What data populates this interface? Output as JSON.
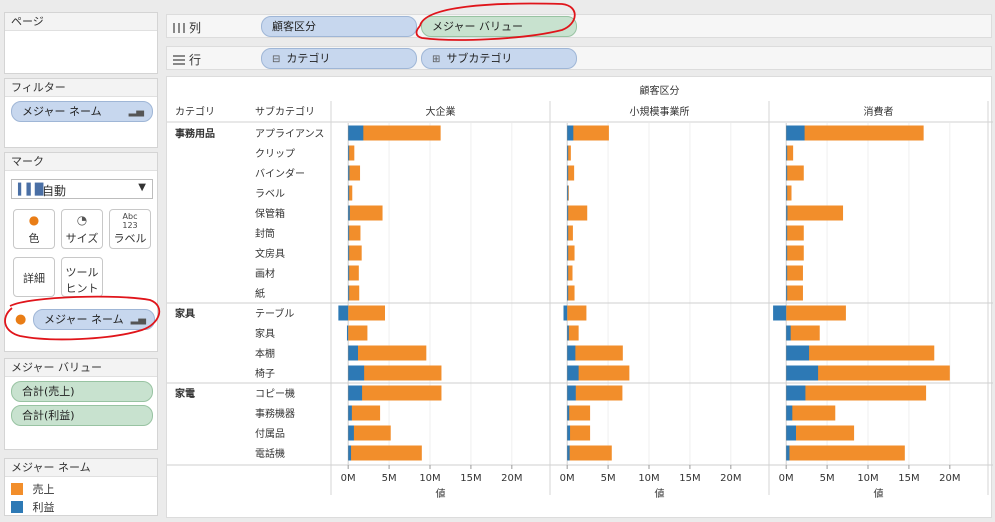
{
  "pages_panel": {
    "title": "ページ"
  },
  "filters_panel": {
    "title": "フィルター",
    "pill": "メジャー ネーム"
  },
  "marks_panel": {
    "title": "マーク",
    "mark_type": "自動",
    "buttons": {
      "color": "色",
      "size": "サイズ",
      "label": "ラベル",
      "detail": "詳細",
      "tooltip_line1": "ツール",
      "tooltip_line2": "ヒント",
      "label_icon_line1": "Abc",
      "label_icon_line2": "123"
    },
    "color_pill": "メジャー ネーム"
  },
  "measure_values_panel": {
    "title": "メジャー バリュー",
    "items": [
      "合計(売上)",
      "合計(利益)"
    ]
  },
  "legend_panel": {
    "title": "メジャー ネーム",
    "items": [
      {
        "label": "売上",
        "color": "#f28e2b"
      },
      {
        "label": "利益",
        "color": "#2d79b5"
      }
    ]
  },
  "columns_shelf": {
    "label": "列",
    "pills": [
      "顧客区分",
      "メジャー バリュー"
    ]
  },
  "rows_shelf": {
    "label": "行",
    "pills": [
      "カテゴリ",
      "サブカテゴリ"
    ],
    "pill_prefix": [
      "⊟",
      "⊞"
    ]
  },
  "chart_data": {
    "type": "bar",
    "orientation": "horizontal",
    "stacked_overlay": true,
    "column_header_title": "顧客区分",
    "row_header_labels": [
      "カテゴリ",
      "サブカテゴリ"
    ],
    "segments": [
      "大企業",
      "小規模事業所",
      "消費者"
    ],
    "xlabel": "値",
    "xlim": [
      -1000000,
      21000000
    ],
    "xticks": [
      0,
      5000000,
      10000000,
      15000000,
      20000000
    ],
    "xtick_labels": [
      "0M",
      "5M",
      "10M",
      "15M",
      "20M"
    ],
    "groups": [
      {
        "category": "事務用品",
        "subcategories": [
          "アプライアンス",
          "クリップ",
          "バインダー",
          "ラベル",
          "保管箱",
          "封筒",
          "文房具",
          "画材",
          "紙"
        ]
      },
      {
        "category": "家具",
        "subcategories": [
          "テーブル",
          "家具",
          "本棚",
          "椅子"
        ]
      },
      {
        "category": "家電",
        "subcategories": [
          "コピー機",
          "事務機器",
          "付属品",
          "電話機"
        ]
      }
    ],
    "series": [
      {
        "name": "売上",
        "color": "#f28e2b",
        "values": [
          [
            11300000,
            5100000,
            16800000
          ],
          [
            750000,
            450000,
            850000
          ],
          [
            1450000,
            850000,
            2150000
          ],
          [
            500000,
            200000,
            650000
          ],
          [
            4200000,
            2450000,
            6950000
          ],
          [
            1500000,
            700000,
            2150000
          ],
          [
            1650000,
            900000,
            2150000
          ],
          [
            1300000,
            650000,
            2050000
          ],
          [
            1350000,
            900000,
            2050000
          ],
          [
            4500000,
            2350000,
            7300000
          ],
          [
            2350000,
            1400000,
            4100000
          ],
          [
            9550000,
            6800000,
            18100000
          ],
          [
            11400000,
            7600000,
            20000000
          ],
          [
            11400000,
            6750000,
            17100000
          ],
          [
            3900000,
            2800000,
            6000000
          ],
          [
            5200000,
            2800000,
            8300000
          ],
          [
            9000000,
            5450000,
            14500000
          ]
        ]
      },
      {
        "name": "利益",
        "color": "#2d79b5",
        "values": [
          [
            1850000,
            750000,
            2250000
          ],
          [
            80000,
            60000,
            60000
          ],
          [
            150000,
            100000,
            100000
          ],
          [
            50000,
            20000,
            40000
          ],
          [
            200000,
            100000,
            150000
          ],
          [
            100000,
            60000,
            100000
          ],
          [
            120000,
            70000,
            100000
          ],
          [
            90000,
            50000,
            80000
          ],
          [
            80000,
            60000,
            80000
          ],
          [
            -1200000,
            -450000,
            -1600000
          ],
          [
            -150000,
            200000,
            550000
          ],
          [
            1200000,
            1000000,
            2800000
          ],
          [
            1950000,
            1400000,
            3900000
          ],
          [
            1700000,
            1050000,
            2350000
          ],
          [
            450000,
            250000,
            750000
          ],
          [
            700000,
            350000,
            1200000
          ],
          [
            350000,
            300000,
            400000
          ]
        ]
      }
    ]
  }
}
